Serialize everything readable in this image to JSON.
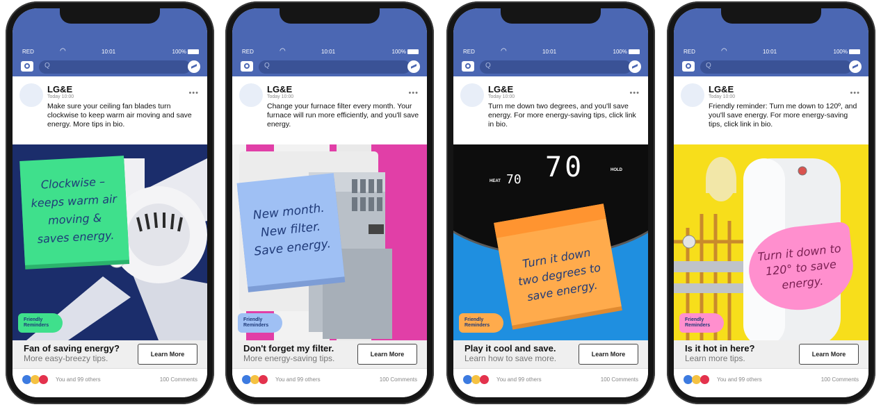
{
  "status": {
    "carrier": "RED",
    "wifi_icon": "wifi-icon",
    "time": "10:01",
    "battery": "100%"
  },
  "search_placeholder": "Q",
  "badge_label": "Friendly Reminders",
  "ads": [
    {
      "author": "LG&E",
      "date": "Today 10:00",
      "text": "Make sure your ceiling fan blades turn clockwise to keep warm air moving and save energy. More tips in bio.",
      "note": "Clockwise – keeps warm air moving & saves energy.",
      "cta_head": "Fan of saving energy?",
      "cta_sub": "More easy-breezy tips.",
      "button": "Learn More",
      "likes": "You and 99 others",
      "comments": "100 Comments"
    },
    {
      "author": "LG&E",
      "date": "Today 10:00",
      "text": "Change your furnace filter every month. Your furnace will run more efficiently, and you'll save energy.",
      "note": "New month. New filter. Save energy.",
      "cta_head": "Don't forget my filter.",
      "cta_sub": "More energy-saving tips.",
      "button": "Learn More",
      "likes": "You and 99 others",
      "comments": "100 Comments"
    },
    {
      "author": "LG&E",
      "date": "Today 10:00",
      "text": "Turn me down two degrees, and you'll save energy. For more energy-saving tips, click link in bio.",
      "note": "Turn it down two degrees to save energy.",
      "thermostat_main": "70",
      "thermostat_heat_label": "HEAT",
      "thermostat_heat": "70",
      "thermostat_hold": "HOLD",
      "cta_head": "Play it cool and save.",
      "cta_sub": "Learn how to save more.",
      "button": "Learn More",
      "likes": "You and 99 others",
      "comments": "100 Comments"
    },
    {
      "author": "LG&E",
      "date": "Today 10:00",
      "text": "Friendly reminder: Turn me down to 120º, and you'll save energy. For more energy-saving tips, click link in bio.",
      "note": "Turn it down to 120° to save energy.",
      "cta_head": "Is it hot in here?",
      "cta_sub": "Learn more tips.",
      "button": "Learn More",
      "likes": "You and 99 others",
      "comments": "100 Comments"
    }
  ],
  "colors": {
    "fb_blue": "#4b67b3",
    "note_green": "#3fe08c",
    "note_blue": "#9fc0f4",
    "note_orange": "#ffab4c",
    "note_pink": "#ff8fce",
    "bg_navy": "#1b2d6b",
    "bg_pink": "#e13fa7",
    "bg_blue": "#1f8fe0",
    "bg_yellow": "#f7de1b"
  }
}
